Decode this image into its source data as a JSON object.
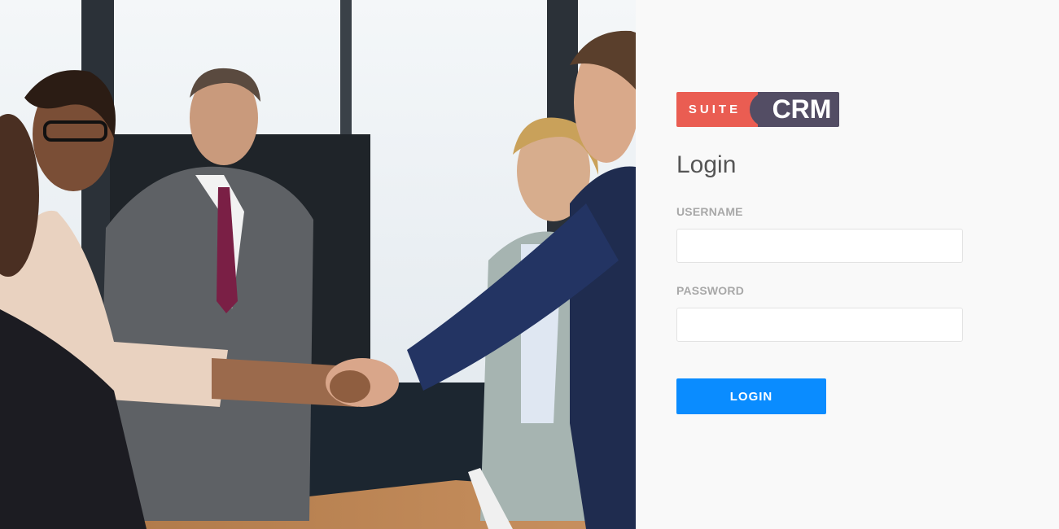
{
  "logo": {
    "left_text": "SUITE",
    "right_text": "CRM",
    "left_color": "#ea5d52",
    "right_color": "#534d64"
  },
  "login": {
    "title": "Login",
    "username_label": "USERNAME",
    "username_value": "",
    "password_label": "PASSWORD",
    "password_value": "",
    "button_label": "LOGIN"
  },
  "colors": {
    "accent": "#0a8cff",
    "panel_background": "#f9f9f9",
    "label_gray": "#a8a8a8",
    "title_gray": "#555555"
  },
  "background_image": {
    "subject": "business-handshake-photo"
  }
}
